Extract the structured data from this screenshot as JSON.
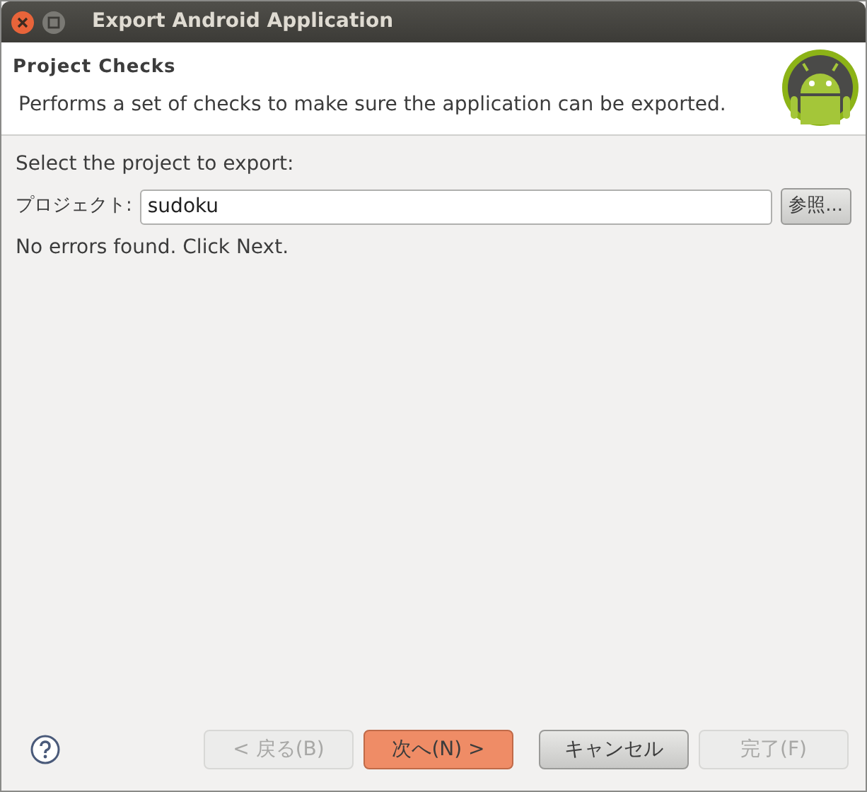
{
  "window": {
    "title": "Export Android Application"
  },
  "header": {
    "title": "Project Checks",
    "description": "Performs a set of checks to make sure the application can be exported."
  },
  "form": {
    "prompt": "Select the project to export:",
    "project_label": "プロジェクト:",
    "project_value": "sudoku",
    "browse_button": "参照...",
    "status": "No errors found. Click Next."
  },
  "buttons": [
    {
      "label": "< 戻る(B)",
      "disabled": true,
      "default": false
    },
    {
      "label": "次へ(N) >",
      "disabled": false,
      "default": true
    },
    {
      "label": "キャンセル",
      "disabled": false,
      "default": false
    },
    {
      "label": "完了(F)",
      "disabled": true,
      "default": false
    }
  ]
}
